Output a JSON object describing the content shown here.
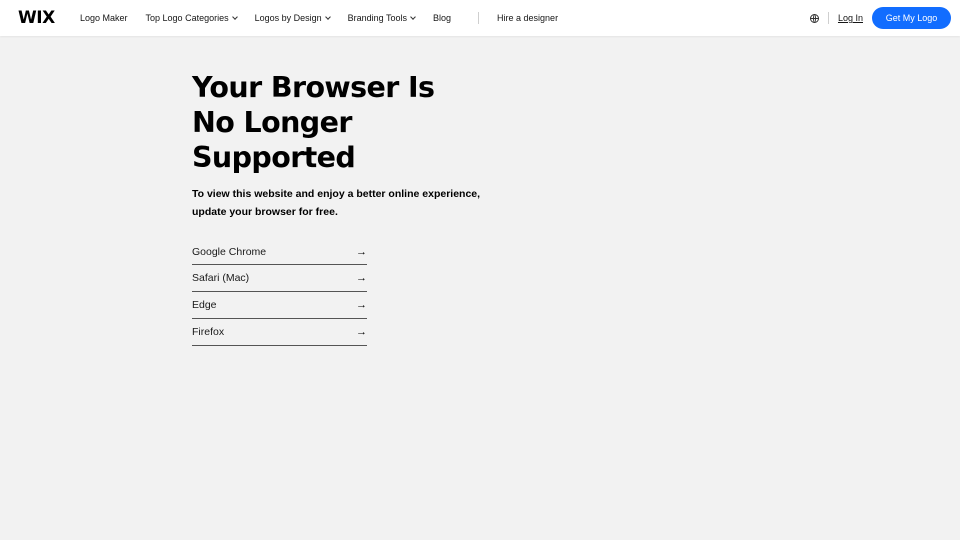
{
  "header": {
    "logo": "WIX",
    "nav": [
      {
        "label": "Logo Maker",
        "has_dropdown": false
      },
      {
        "label": "Top Logo Categories",
        "has_dropdown": true
      },
      {
        "label": "Logos by Design",
        "has_dropdown": true
      },
      {
        "label": "Branding Tools",
        "has_dropdown": true
      },
      {
        "label": "Blog",
        "has_dropdown": false
      }
    ],
    "hire_label": "Hire a designer",
    "language_icon": "globe-icon",
    "login_label": "Log In",
    "cta_label": "Get My Logo",
    "cta_color": "#116dff"
  },
  "main": {
    "headline_line1": "Your Browser Is",
    "headline_line2": "No Longer Supported",
    "subtext_line1": "To view this website and enjoy a better online experience,",
    "subtext_line2": "update your browser for free.",
    "browsers": [
      {
        "label": "Google Chrome",
        "icon": "arrow-right-icon"
      },
      {
        "label": "Safari (Mac)",
        "icon": "arrow-right-icon"
      },
      {
        "label": "Edge",
        "icon": "arrow-right-icon"
      },
      {
        "label": "Firefox",
        "icon": "arrow-right-icon"
      }
    ]
  }
}
